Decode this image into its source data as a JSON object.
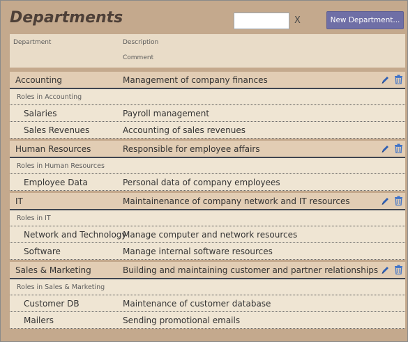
{
  "page": {
    "title": "Departments",
    "search_value": "",
    "clear_label": "X",
    "new_button_label": "New Department..."
  },
  "columns": {
    "department": "Department",
    "description": "Description",
    "comment": "Comment"
  },
  "icons": {
    "edit": "pencil-icon",
    "delete": "trash-icon"
  },
  "colors": {
    "accent_button": "#6f6fa6",
    "edit_icon": "#2f5fb3",
    "delete_icon": "#3f73c8"
  },
  "departments": [
    {
      "name": "Accounting",
      "description": "Management of company finances",
      "roles_label": "Roles in Accounting",
      "roles": [
        {
          "name": "Salaries",
          "description": "Payroll management"
        },
        {
          "name": "Sales Revenues",
          "description": "Accounting of sales revenues"
        }
      ]
    },
    {
      "name": "Human Resources",
      "description": "Responsible for employee affairs",
      "roles_label": "Roles in Human Resources",
      "roles": [
        {
          "name": "Employee Data",
          "description": "Personal data of company employees"
        }
      ]
    },
    {
      "name": "IT",
      "description": "Maintainenance of company network and IT resources",
      "roles_label": "Roles in IT",
      "roles": [
        {
          "name": "Network and Technology",
          "description": "Manage computer and network resources"
        },
        {
          "name": "Software",
          "description": "Manage internal software resources"
        }
      ]
    },
    {
      "name": "Sales & Marketing",
      "description": "Building and maintaining customer and partner relationships",
      "roles_label": "Roles in Sales & Marketing",
      "roles": [
        {
          "name": "Customer DB",
          "description": "Maintenance of customer database"
        },
        {
          "name": "Mailers",
          "description": "Sending promotional emails"
        }
      ]
    }
  ]
}
